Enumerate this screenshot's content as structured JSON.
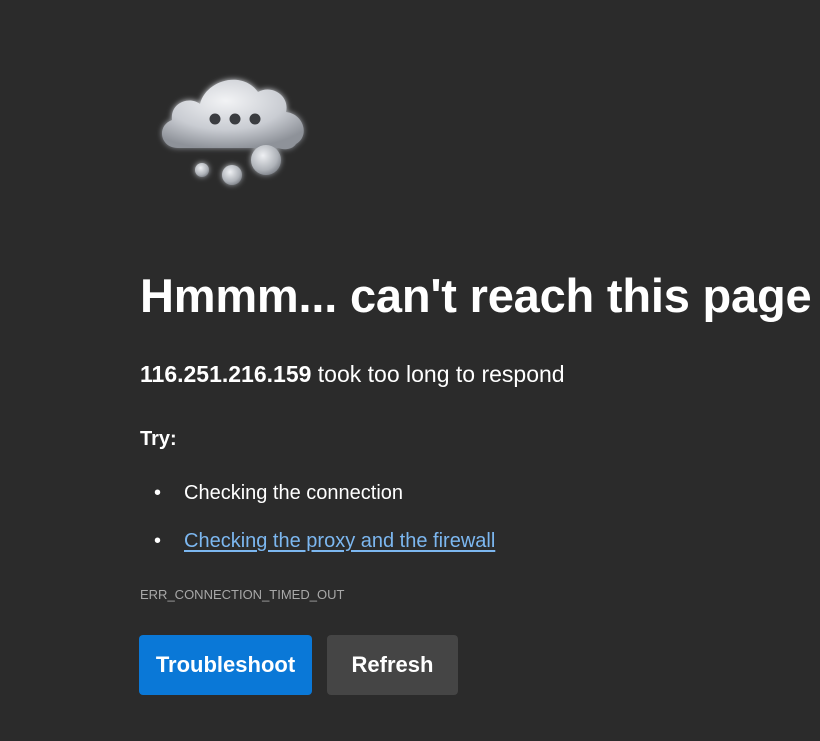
{
  "error": {
    "icon": "cloud-thinking-icon",
    "heading": "Hmmm... can't reach this page",
    "host": "116.251.216.159",
    "message_suffix": " took too long to respond",
    "try_label": "Try:",
    "suggestions": [
      {
        "text": "Checking the connection",
        "is_link": false
      },
      {
        "text": "Checking the proxy and the firewall",
        "is_link": true
      }
    ],
    "error_code": "ERR_CONNECTION_TIMED_OUT"
  },
  "buttons": {
    "troubleshoot_label": "Troubleshoot",
    "refresh_label": "Refresh"
  },
  "colors": {
    "background": "#2b2b2b",
    "primary_button": "#0a78d7",
    "secondary_button": "#454545",
    "link": "#7cb7f0"
  }
}
